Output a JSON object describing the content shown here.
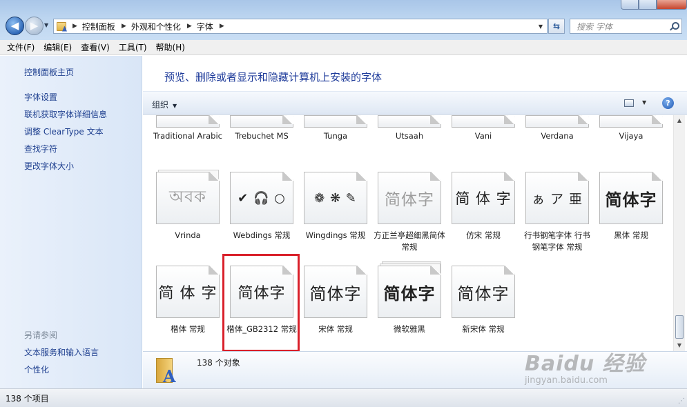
{
  "nav": {
    "breadcrumbs": [
      "控制面板",
      "外观和个性化",
      "字体"
    ],
    "search_placeholder": "搜索 字体"
  },
  "menu": [
    "文件(F)",
    "编辑(E)",
    "查看(V)",
    "工具(T)",
    "帮助(H)"
  ],
  "sidebar": {
    "home": "控制面板主页",
    "links": [
      "字体设置",
      "联机获取字体详细信息",
      "调整 ClearType 文本",
      "查找字符",
      "更改字体大小"
    ],
    "see_also_heading": "另请参阅",
    "see_also": [
      "文本服务和输入语言",
      "个性化"
    ]
  },
  "main": {
    "heading": "预览、删除或者显示和隐藏计算机上安装的字体",
    "organize_label": "组织",
    "help_label": "?"
  },
  "fonts": {
    "row1": [
      "Traditional Arabic",
      "Trebuchet MS",
      "Tunga",
      "Utsaah",
      "Vani",
      "Verdana",
      "Vijaya"
    ],
    "row2": [
      {
        "label": "Vrinda",
        "preview": "অবক"
      },
      {
        "label": "Webdings 常规",
        "preview": "✔ 🎧 ○"
      },
      {
        "label": "Wingdings 常规",
        "preview": "❁ ❋ ✎"
      },
      {
        "label": "方正兰亭超细黑简体 常规",
        "preview": "简体字"
      },
      {
        "label": "仿宋 常规",
        "preview": "简 体 字"
      },
      {
        "label": "行书钢笔字体 行书钢笔字体 常规",
        "preview": "ぁ ア 亜"
      },
      {
        "label": "黑体 常规",
        "preview": "简体字"
      }
    ],
    "row3": [
      {
        "label": "楷体 常规",
        "preview": "简 体 字"
      },
      {
        "label": "楷体_GB2312 常规",
        "preview": "简体字"
      },
      {
        "label": "宋体 常规",
        "preview": "简体字"
      },
      {
        "label": "微软雅黑",
        "preview": "简体字"
      },
      {
        "label": "新宋体 常规",
        "preview": "简体字"
      }
    ]
  },
  "details": {
    "count": "138 个对象"
  },
  "status": {
    "items": "138 个项目"
  },
  "watermark": {
    "logo": "Baidu 经验",
    "url": "jingyan.baidu.com"
  },
  "colors": {
    "highlight": "#d9202a",
    "link": "#1e3f8f",
    "heading": "#1e3b9a"
  }
}
